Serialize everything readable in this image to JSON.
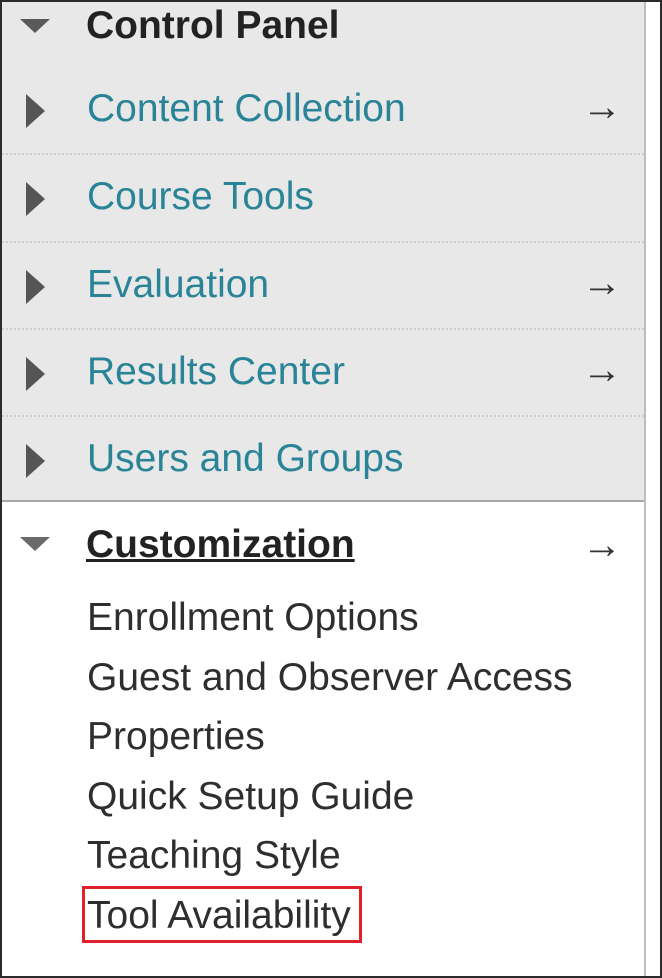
{
  "control_panel": {
    "title": "Control Panel",
    "items": [
      {
        "label": "Content Collection",
        "has_arrow": true
      },
      {
        "label": "Course Tools",
        "has_arrow": false
      },
      {
        "label": "Evaluation",
        "has_arrow": true
      },
      {
        "label": "Results Center",
        "has_arrow": true
      },
      {
        "label": "Users and Groups",
        "has_arrow": false
      }
    ]
  },
  "customization": {
    "title": "Customization",
    "arrow": "→",
    "items": [
      {
        "label": "Enrollment Options"
      },
      {
        "label": "Guest and Observer Access"
      },
      {
        "label": "Properties"
      },
      {
        "label": "Quick Setup Guide"
      },
      {
        "label": "Teaching Style"
      },
      {
        "label": "Tool Availability",
        "highlighted": true
      }
    ]
  },
  "arrow_glyph": "→",
  "colors": {
    "link_teal": "#2a8497",
    "section_gray": "#e8e8e8",
    "highlight_red": "#e0202a"
  },
  "icons": {
    "expanded": "caret-down-icon",
    "collapsed": "caret-right-icon",
    "navigate": "right-arrow-icon"
  }
}
